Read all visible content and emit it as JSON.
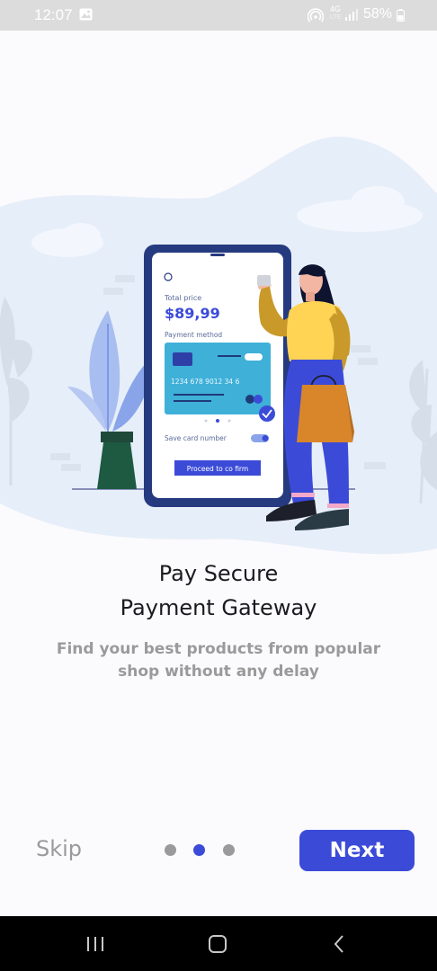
{
  "status_bar": {
    "time": "12:07",
    "network_type": "4G",
    "network_sub": "LTE",
    "battery": "58%"
  },
  "illustration": {
    "total_price_label": "Total price",
    "total_price": "$89,99",
    "payment_method_label": "Payment method",
    "card_number": "1234  678  9012  34  6",
    "save_card_label": "Save card number",
    "proceed_label": "Proceed to co  firm"
  },
  "onboarding": {
    "title_line1": "Pay Secure",
    "title_line2": "Payment Gateway",
    "subtitle": "Find your best products from popular shop without any delay"
  },
  "footer": {
    "skip_label": "Skip",
    "next_label": "Next",
    "total_pages": 3,
    "current_page": 2
  },
  "colors": {
    "accent": "#3b4bd8",
    "muted": "#9a9a9a",
    "title": "#1b1b1f",
    "background": "#fbfafd"
  },
  "icons": [
    "gallery-icon",
    "hotspot-icon",
    "signal-icon",
    "battery-icon",
    "recents-icon",
    "home-icon",
    "back-icon"
  ]
}
